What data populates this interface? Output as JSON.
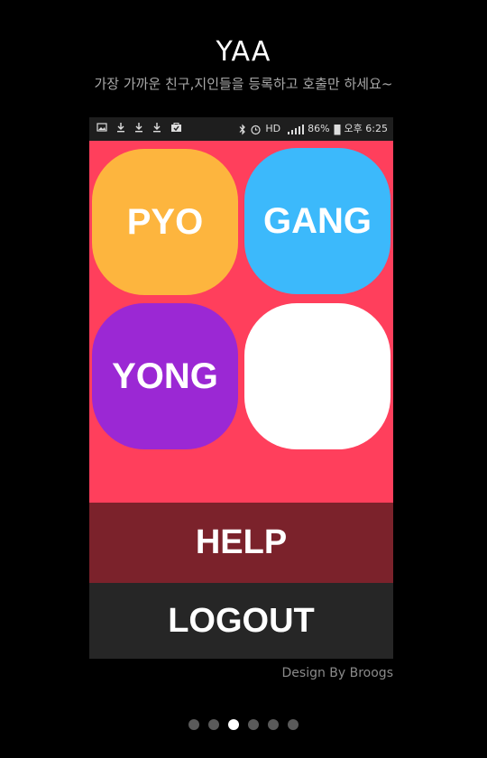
{
  "header": {
    "title": "YAA",
    "subtitle": "가장 가까운 친구,지인들을 등록하고 호출만 하세요~"
  },
  "statusbar": {
    "hd_label": "HD",
    "battery": "86%",
    "time": "오후 6:25"
  },
  "tiles": [
    {
      "label": "PYO",
      "color": "#fdb53e"
    },
    {
      "label": "GANG",
      "color": "#3cb9fb"
    },
    {
      "label": "YONG",
      "color": "#9b28d4"
    },
    {
      "label": "",
      "color": "#ffffff"
    }
  ],
  "buttons": {
    "help": "HELP",
    "logout": "LOGOUT"
  },
  "colors": {
    "screen_bg": "#ff3f5c",
    "help_bg": "#7b222b",
    "logout_bg": "#262626"
  },
  "footer": {
    "credit": "Design By Broogs"
  },
  "pagination": {
    "total": 6,
    "active_index": 2
  }
}
